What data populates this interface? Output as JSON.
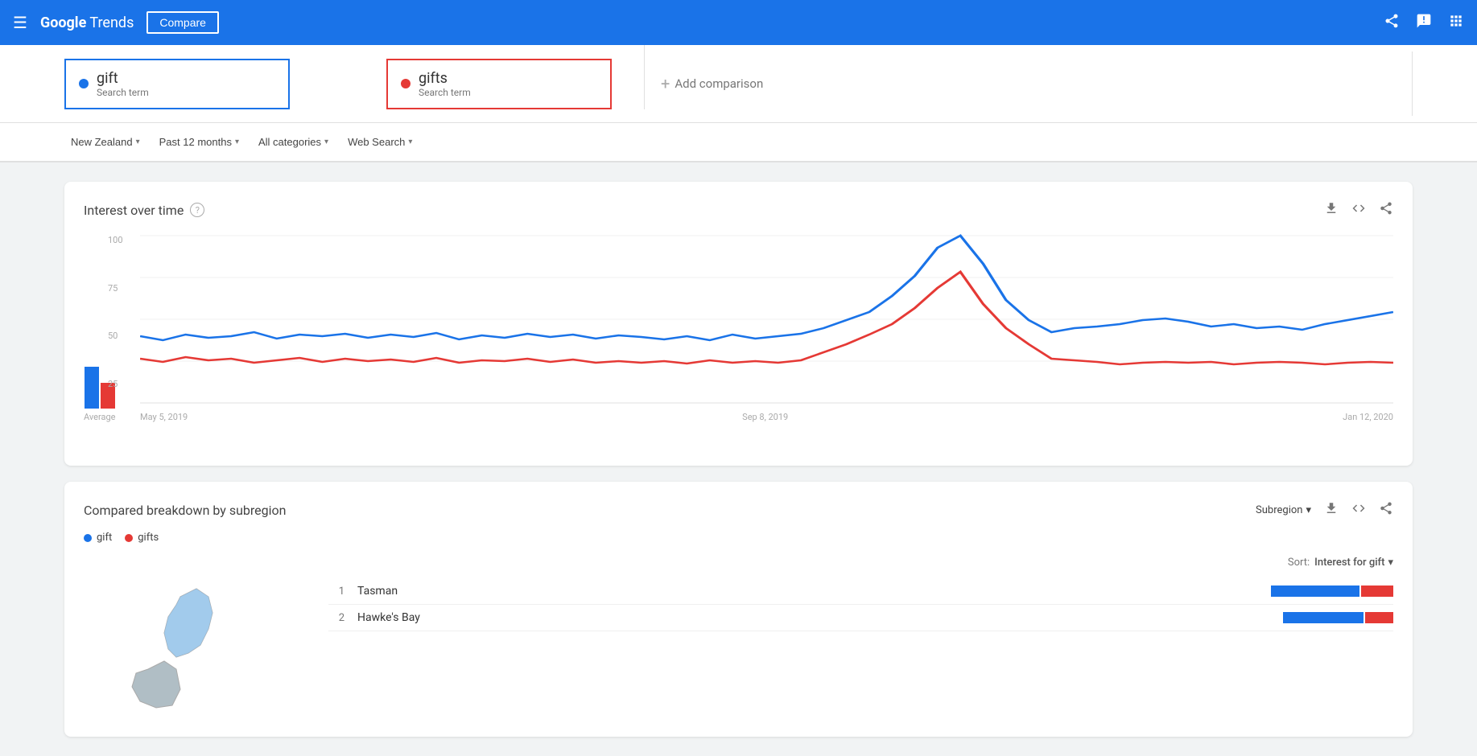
{
  "header": {
    "menu_icon": "☰",
    "logo_google": "Google",
    "logo_trends": " Trends",
    "nav_compare": "Compare",
    "share_icon": "share",
    "feedback_icon": "feedback",
    "apps_icon": "apps"
  },
  "search_terms": [
    {
      "id": "term1",
      "name": "gift",
      "label": "Search term",
      "dot_color": "blue",
      "border_color": "blue"
    },
    {
      "id": "term2",
      "name": "gifts",
      "label": "Search term",
      "dot_color": "red",
      "border_color": "red"
    }
  ],
  "add_comparison": {
    "label": "Add comparison",
    "plus": "+"
  },
  "filters": [
    {
      "id": "region",
      "label": "New Zealand",
      "has_chevron": true
    },
    {
      "id": "period",
      "label": "Past 12 months",
      "has_chevron": true
    },
    {
      "id": "categories",
      "label": "All categories",
      "has_chevron": true
    },
    {
      "id": "search_type",
      "label": "Web Search",
      "has_chevron": true
    }
  ],
  "interest_over_time": {
    "title": "Interest over time",
    "y_labels": [
      "100",
      "75",
      "50",
      "25"
    ],
    "x_labels": [
      "May 5, 2019",
      "Sep 8, 2019",
      "Jan 12, 2020"
    ],
    "average_label": "Average",
    "download_icon": "⬇",
    "embed_icon": "<>",
    "share_icon": "share"
  },
  "subregion": {
    "title": "Compared breakdown by subregion",
    "dropdown_label": "Subregion",
    "sort_label": "Sort:",
    "sort_value": "Interest for gift",
    "legend": [
      {
        "label": "gift",
        "color": "blue"
      },
      {
        "label": "gifts",
        "color": "red"
      }
    ],
    "rankings": [
      {
        "rank": 1,
        "name": "Tasman",
        "blue_width": 110,
        "red_width": 40
      },
      {
        "rank": 2,
        "name": "Hawke's Bay",
        "blue_width": 100,
        "red_width": 35
      }
    ]
  }
}
